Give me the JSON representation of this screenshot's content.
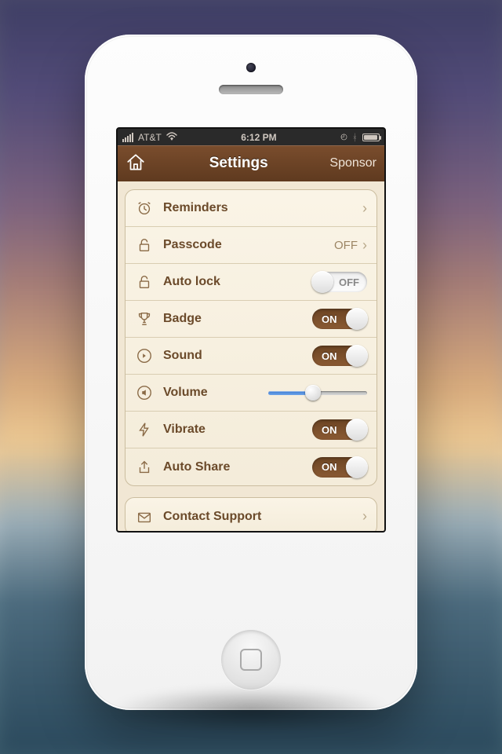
{
  "status": {
    "carrier": "AT&T",
    "time": "6:12 PM"
  },
  "nav": {
    "title": "Settings",
    "sponsor": "Sponsor"
  },
  "rows": {
    "reminders": {
      "label": "Reminders"
    },
    "passcode": {
      "label": "Passcode",
      "value": "OFF"
    },
    "autolock": {
      "label": "Auto lock",
      "toggle": "OFF",
      "on": false
    },
    "badge": {
      "label": "Badge",
      "toggle": "ON",
      "on": true
    },
    "sound": {
      "label": "Sound",
      "toggle": "ON",
      "on": true
    },
    "volume": {
      "label": "Volume",
      "percent": 45
    },
    "vibrate": {
      "label": "Vibrate",
      "toggle": "ON",
      "on": true
    },
    "autoshare": {
      "label": "Auto Share",
      "toggle": "ON",
      "on": true
    },
    "contact": {
      "label": "Contact Support"
    }
  },
  "colors": {
    "accent": "#6b4423",
    "bg": "#f1e7d4"
  }
}
